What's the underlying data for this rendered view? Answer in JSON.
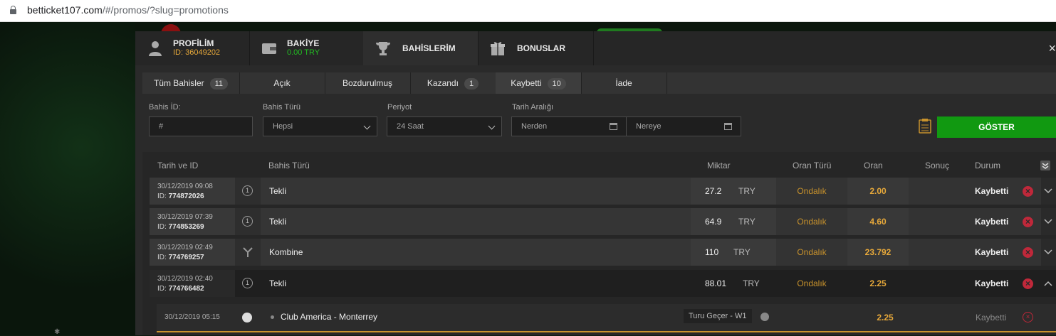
{
  "browser": {
    "url_host": "betticket107.com",
    "url_path": "/#/promos/?slug=promotions"
  },
  "tabs": [
    {
      "label": "PROFİLİM",
      "sub": "ID: 36049202",
      "icon": "user-icon"
    },
    {
      "label": "BAKİYE",
      "sub": "0.00 TRY",
      "icon": "wallet-icon"
    },
    {
      "label": "BAHİSLERİM",
      "icon": "trophy-icon"
    },
    {
      "label": "BONUSLAR",
      "icon": "gift-icon"
    }
  ],
  "close_label": "×",
  "subtabs": [
    {
      "label": "Tüm Bahisler",
      "count": "11"
    },
    {
      "label": "Açık"
    },
    {
      "label": "Bozdurulmuş"
    },
    {
      "label": "Kazandı",
      "count": "1"
    },
    {
      "label": "Kaybetti",
      "count": "10"
    },
    {
      "label": "İade"
    }
  ],
  "filters": {
    "bet_id_label": "Bahis İD:",
    "bet_id_placeholder": "#",
    "bet_type_label": "Bahis Türü",
    "bet_type_value": "Hepsi",
    "period_label": "Periyot",
    "period_value": "24 Saat",
    "date_range_label": "Tarih Aralığı",
    "from_placeholder": "Nerden",
    "to_placeholder": "Nereye",
    "show_button": "GÖSTER"
  },
  "columns": {
    "date_id": "Tarih ve ID",
    "bet_type": "Bahis Türü",
    "amount": "Miktar",
    "odds_type": "Oran Türü",
    "odds": "Oran",
    "result": "Sonuç",
    "status": "Durum"
  },
  "rows": [
    {
      "date": "30/12/2019 09:08",
      "id_prefix": "ID: ",
      "id": "774872026",
      "type": "Tekli",
      "amount": "27.2",
      "currency": "TRY",
      "odds_type": "Ondalık",
      "odds": "2.00",
      "status": "Kaybetti",
      "icon_glyph": "1"
    },
    {
      "date": "30/12/2019 07:39",
      "id_prefix": "ID: ",
      "id": "774853269",
      "type": "Tekli",
      "amount": "64.9",
      "currency": "TRY",
      "odds_type": "Ondalık",
      "odds": "4.60",
      "status": "Kaybetti",
      "icon_glyph": "1"
    },
    {
      "date": "30/12/2019 02:49",
      "id_prefix": "ID: ",
      "id": "774769257",
      "type": "Kombine",
      "amount": "110",
      "currency": "TRY",
      "odds_type": "Ondalık",
      "odds": "23.792",
      "status": "Kaybetti",
      "icon_glyph": ""
    },
    {
      "date": "30/12/2019 02:40",
      "id_prefix": "ID: ",
      "id": "774766482",
      "type": "Tekli",
      "amount": "88.01",
      "currency": "TRY",
      "odds_type": "Ondalık",
      "odds": "2.25",
      "status": "Kaybetti",
      "icon_glyph": "1"
    }
  ],
  "detail": {
    "datetime": "30/12/2019 05:15",
    "match": "Club America - Monterrey",
    "market": "Turu Geçer - W1",
    "odds": "2.25",
    "status": "Kaybetti"
  },
  "colors": {
    "accent_green": "#119911",
    "odds_orange": "#e6a83a",
    "lost_red": "#c0283a"
  }
}
